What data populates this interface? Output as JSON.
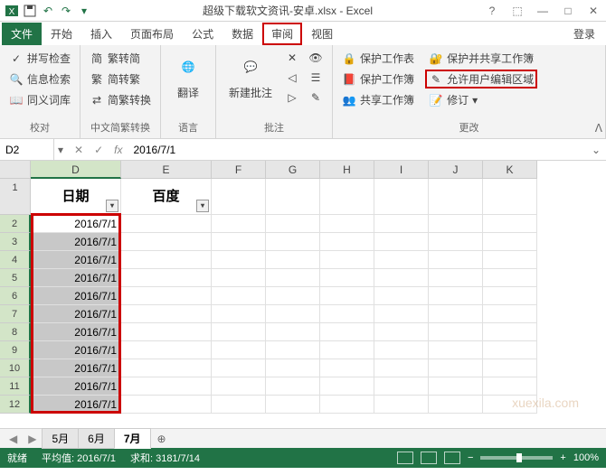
{
  "titlebar": {
    "title": "超级下载软文资讯-安卓.xlsx - Excel"
  },
  "menu": {
    "file": "文件",
    "home": "开始",
    "insert": "插入",
    "pagelayout": "页面布局",
    "formulas": "公式",
    "data": "数据",
    "review": "审阅",
    "view": "视图",
    "login": "登录"
  },
  "ribbon": {
    "spellcheck": "拼写检查",
    "research": "信息检索",
    "thesaurus": "同义词库",
    "group_proof": "校对",
    "trad2simp": "繁转简",
    "simp2trad": "简转繁",
    "simp_trad_conv": "简繁转换",
    "group_chinese": "中文简繁转换",
    "translate": "翻译",
    "group_lang": "语言",
    "new_comment": "新建批注",
    "group_comment": "批注",
    "protect_sheet": "保护工作表",
    "protect_workbook": "保护工作簿",
    "share_workbook": "共享工作簿",
    "protect_share": "保护并共享工作簿",
    "allow_edit_ranges": "允许用户编辑区域",
    "track_changes": "修订",
    "group_changes": "更改"
  },
  "namebox": "D2",
  "formula": "2016/7/1",
  "columns": [
    "D",
    "E",
    "F",
    "G",
    "H",
    "I",
    "J",
    "K"
  ],
  "header_row": {
    "D": "日期",
    "E": "百度"
  },
  "rows": [
    {
      "n": 2,
      "D": "2016/7/1"
    },
    {
      "n": 3,
      "D": "2016/7/1"
    },
    {
      "n": 4,
      "D": "2016/7/1"
    },
    {
      "n": 5,
      "D": "2016/7/1"
    },
    {
      "n": 6,
      "D": "2016/7/1"
    },
    {
      "n": 7,
      "D": "2016/7/1"
    },
    {
      "n": 8,
      "D": "2016/7/1"
    },
    {
      "n": 9,
      "D": "2016/7/1"
    },
    {
      "n": 10,
      "D": "2016/7/1"
    },
    {
      "n": 11,
      "D": "2016/7/1"
    },
    {
      "n": 12,
      "D": "2016/7/1"
    }
  ],
  "sheets": {
    "s1": "5月",
    "s2": "6月",
    "s3": "7月"
  },
  "status": {
    "ready": "就绪",
    "avg_label": "平均值:",
    "avg_val": "2016/7/1",
    "sum_label": "求和:",
    "sum_val": "3181/7/14",
    "zoom": "100%"
  },
  "watermark": "xuexila.com"
}
